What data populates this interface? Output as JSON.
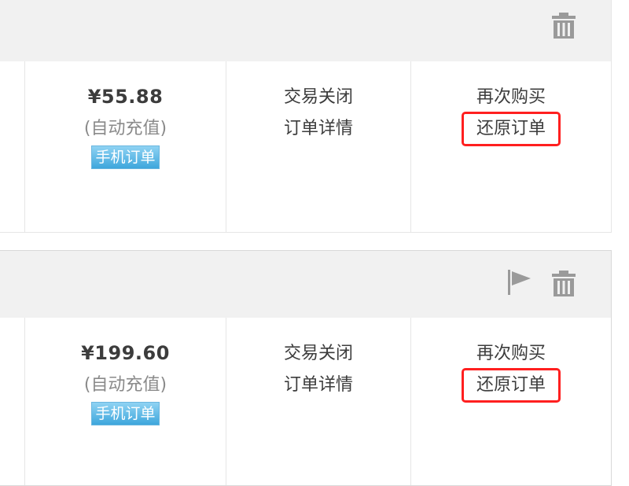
{
  "orders": [
    {
      "price": "¥55.88",
      "price_note": "(自动充值)",
      "tag": "手机订单",
      "status": "交易关闭",
      "detail_link": "订单详情",
      "buy_again": "再次购买",
      "restore": "还原订单",
      "header_icons": [
        "trash-icon"
      ]
    },
    {
      "price": "¥199.60",
      "price_note": "(自动充值)",
      "tag": "手机订单",
      "status": "交易关闭",
      "detail_link": "订单详情",
      "buy_again": "再次购买",
      "restore": "还原订单",
      "header_icons": [
        "flag-icon",
        "trash-icon"
      ]
    }
  ],
  "colors": {
    "header_bg": "#f1f1f1",
    "highlight_border": "#ff1f1f",
    "tag_bg": "#3ea6dc",
    "icon": "#9a9a9a"
  }
}
